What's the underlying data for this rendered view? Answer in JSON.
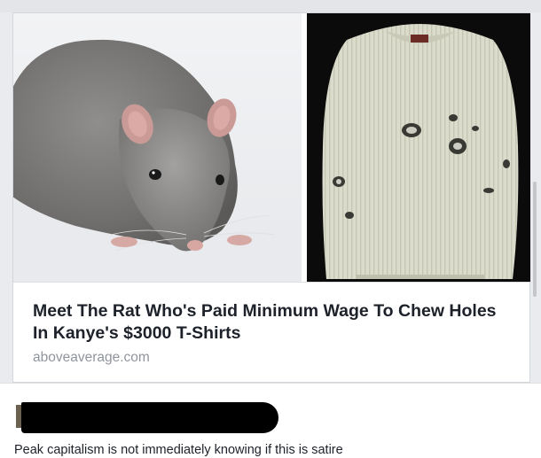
{
  "post": {
    "headline": "Meet The Rat Who's Paid Minimum Wage To Chew Holes In Kanye's $3000 T-Shirts",
    "domain": "aboveaverage.com",
    "images": [
      "rat-photo",
      "distressed-sweater-photo"
    ]
  },
  "comment": {
    "text": "Peak capitalism is not immediately knowing if this is satire"
  },
  "colors": {
    "headline": "#1d2129",
    "domain": "#90949c",
    "background": "#e9ebee",
    "card": "#ffffff"
  }
}
